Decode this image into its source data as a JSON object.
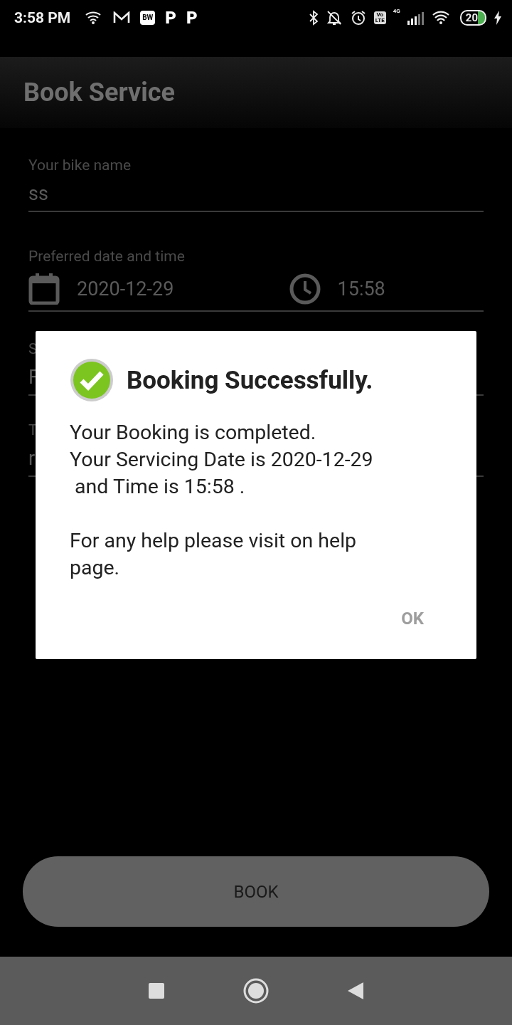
{
  "status_bar": {
    "time": "3:58 PM",
    "app_badge": "BW",
    "app_letters": [
      "P",
      "P"
    ],
    "volte": [
      "Vo",
      "LTE"
    ],
    "network": "4G",
    "battery": "20"
  },
  "app_bar": {
    "title": "Book Service"
  },
  "form": {
    "bike_name": {
      "label": "Your bike name",
      "value": "ss"
    },
    "schedule": {
      "label": "Preferred date and time",
      "date": "2020-12-29",
      "time": "15:58"
    },
    "field_3": {
      "label": "S",
      "value": "F"
    },
    "field_4": {
      "label": "T",
      "value": "r"
    }
  },
  "book_button": "BOOK",
  "dialog": {
    "title": "Booking Successfully.",
    "message": "Your Booking is completed.\nYour Servicing Date is 2020-12-29\n and Time is 15:58 .\n\nFor any help please visit on help page.",
    "ok": "OK"
  }
}
